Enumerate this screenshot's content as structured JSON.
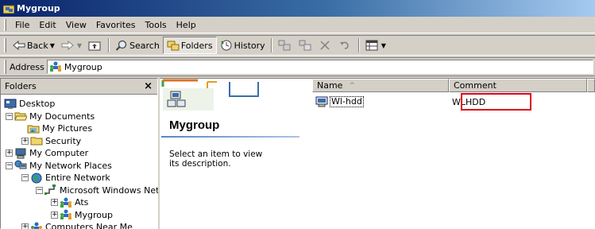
{
  "window": {
    "title": "Mygroup"
  },
  "menu": [
    "File",
    "Edit",
    "View",
    "Favorites",
    "Tools",
    "Help"
  ],
  "toolbar": {
    "back_label": "Back",
    "search_label": "Search",
    "folders_label": "Folders",
    "history_label": "History"
  },
  "address": {
    "label": "Address",
    "value": "Mygroup"
  },
  "folders_pane": {
    "title": "Folders",
    "close": "×",
    "tree": [
      {
        "label": "Desktop"
      },
      {
        "label": "My Documents"
      },
      {
        "label": "My Pictures"
      },
      {
        "label": "Security"
      },
      {
        "label": "My Computer"
      },
      {
        "label": "My Network Places"
      },
      {
        "label": "Entire Network"
      },
      {
        "label": "Microsoft Windows Netw"
      },
      {
        "label": "Ats"
      },
      {
        "label": "Mygroup"
      },
      {
        "label": "Computers Near Me"
      }
    ]
  },
  "webview": {
    "folder_title": "Mygroup",
    "description": "Select an item to view its description."
  },
  "list": {
    "columns": [
      {
        "label": "Name",
        "sort": "^"
      },
      {
        "label": "Comment"
      }
    ],
    "rows": [
      {
        "name": "Wl-hdd",
        "comment": "WLHDD"
      }
    ]
  },
  "colors": {
    "title_gradient_start": "#0a246a",
    "title_gradient_end": "#a6caf0",
    "highlight_box": "#e0001a"
  }
}
